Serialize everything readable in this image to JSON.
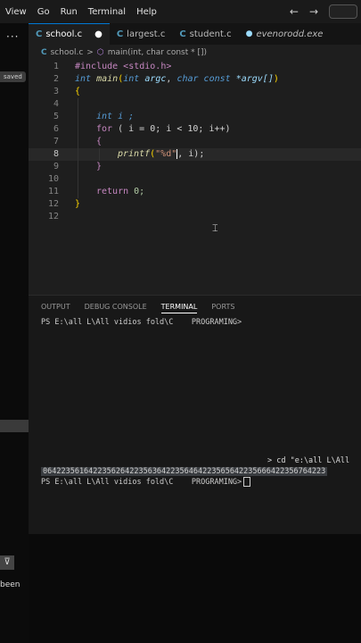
{
  "menu": [
    "View",
    "Go",
    "Run",
    "Terminal",
    "Help"
  ],
  "nav": {
    "back": "←",
    "forward": "→"
  },
  "left": {
    "dots": "···",
    "saved": "saved",
    "been": "been",
    "filter": "⊽"
  },
  "tabs": [
    {
      "label": "school.c",
      "active": true,
      "modified": "●"
    },
    {
      "label": "largest.c"
    },
    {
      "label": "student.c"
    },
    {
      "label": "evenorodd.exe"
    }
  ],
  "breadcrumb": {
    "file": "school.c",
    "sep": ">",
    "symbol": "main(int, char const * [])"
  },
  "editor": {
    "line_numbers": [
      "1",
      "2",
      "3",
      "4",
      "5",
      "6",
      "7",
      "8",
      "9",
      "10",
      "11",
      "12"
    ],
    "include": "#include <stdio.h>",
    "main_sig": {
      "type": "int",
      "name": "main",
      "p1_type": "int",
      "p1": "argc",
      "p2_type": "char const",
      "p2": "*argv[]"
    },
    "decl": "int i ;",
    "for_kw": "for",
    "for_body": "( i = 0; i < 10; i++)",
    "printf": "printf",
    "fmt": "\"%d\"",
    "printf_rest": ", i);",
    "return_kw": "return",
    "return_val": "0;"
  },
  "panel": {
    "tabs": [
      "OUTPUT",
      "DEBUG CONSOLE",
      "TERMINAL",
      "PORTS"
    ],
    "active_tab": "TERMINAL",
    "prompt1": "PS E:\\all L\\All vidios fold\\C    PROGRAMING>",
    "cmd": "> cd \"e:\\all L\\All",
    "output": "06422356164223562642235636422356464223565642235666422356764223",
    "prompt2": "PS E:\\all L\\All vidios fold\\C    PROGRAMING>"
  }
}
